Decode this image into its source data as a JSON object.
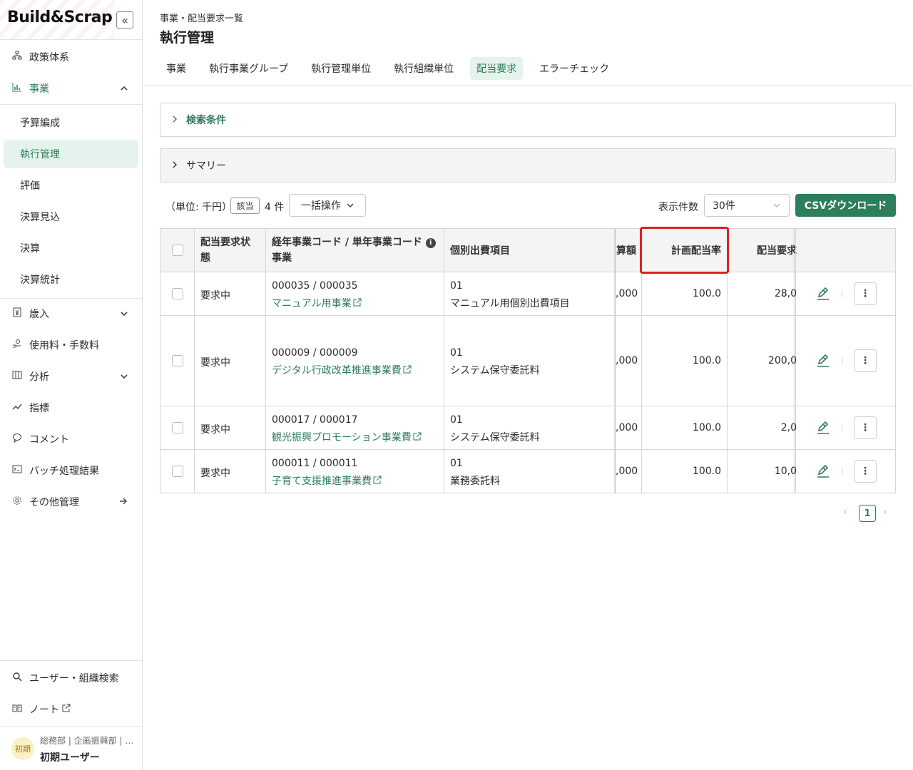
{
  "app": {
    "logo": "Build&Scrap",
    "collapse_icon": "«"
  },
  "sidebar": {
    "items": [
      {
        "label": "政策体系",
        "icon": "org-chart-icon"
      },
      {
        "label": "事業",
        "icon": "bar-chart-icon"
      },
      {
        "label": "歳入",
        "icon": "yen-doc-icon"
      },
      {
        "label": "使用料・手数料",
        "icon": "hand-coin-icon"
      },
      {
        "label": "分析",
        "icon": "panel-icon"
      },
      {
        "label": "指標",
        "icon": "trend-icon"
      },
      {
        "label": "コメント",
        "icon": "comment-icon"
      },
      {
        "label": "バッチ処理結果",
        "icon": "terminal-icon"
      },
      {
        "label": "その他管理",
        "icon": "gear-icon"
      }
    ],
    "sub_items": [
      "予算編成",
      "執行管理",
      "評価",
      "決算見込",
      "決算",
      "決算統計"
    ],
    "bottom": [
      {
        "label": "ユーザー・組織検索",
        "icon": "search-icon"
      },
      {
        "label": "ノート",
        "icon": "book-icon"
      }
    ],
    "user": {
      "avatar": "初期",
      "dept": "総務部 | 企画振興部 | …",
      "name": "初期ユーザー"
    }
  },
  "header": {
    "breadcrumb": "事業・配当要求一覧",
    "title": "執行管理",
    "tabs": [
      "事業",
      "執行事業グループ",
      "執行管理単位",
      "執行組織単位",
      "配当要求",
      "エラーチェック"
    ],
    "active_tab": "配当要求"
  },
  "panels": {
    "search": "検索条件",
    "summary": "サマリー"
  },
  "toolbar": {
    "unit": "（単位: 千円）",
    "hit_badge": "該当",
    "hit_count": "4 件",
    "bulk_action": "一括操作",
    "per_page_label": "表示件数",
    "per_page_value": "30件",
    "csv_button": "CSVダウンロード"
  },
  "table": {
    "headers": {
      "status": "配当要求状態",
      "code_line1": "経年事業コード / 単年事業コード",
      "code_line2": "事業",
      "expense": "個別出費項目",
      "budget": "算額",
      "rate": "計画配当率",
      "request": "配当要求"
    },
    "rows": [
      {
        "status": "要求中",
        "code": "000035 / 000035",
        "project": "マニュアル用事業",
        "exp_code": "01",
        "exp_name": "マニュアル用個別出費項目",
        "budget": ",000",
        "rate": "100.0",
        "request": "28,0"
      },
      {
        "status": "要求中",
        "code": "000009 / 000009",
        "project": "デジタル行政改革推進事業費",
        "exp_code": "01",
        "exp_name": "システム保守委託料",
        "budget": ",000",
        "rate": "100.0",
        "request": "200,0"
      },
      {
        "status": "要求中",
        "code": "000017 / 000017",
        "project": "観光振興プロモーション事業費",
        "exp_code": "01",
        "exp_name": "システム保守委託料",
        "budget": ",000",
        "rate": "100.0",
        "request": "2,0"
      },
      {
        "status": "要求中",
        "code": "000011 / 000011",
        "project": "子育て支援推進事業費",
        "exp_code": "01",
        "exp_name": "業務委託料",
        "budget": ",000",
        "rate": "100.0",
        "request": "10,0"
      }
    ]
  },
  "pagination": {
    "current": "1",
    "prev": "‹",
    "next": "›"
  },
  "colors": {
    "accent": "#2e7d5b",
    "highlight": "#e02020"
  }
}
